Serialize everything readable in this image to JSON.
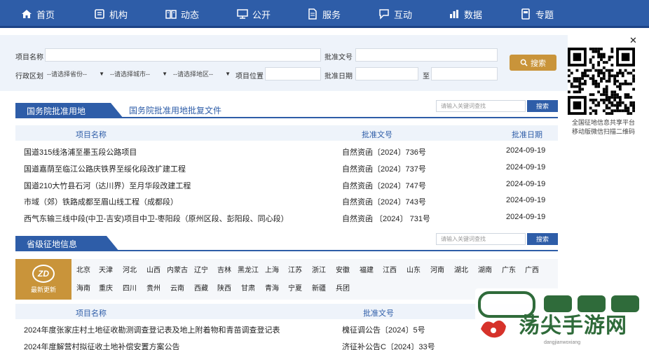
{
  "nav": {
    "items": [
      {
        "label": "首页",
        "icon": "home-icon"
      },
      {
        "label": "机构",
        "icon": "building-icon"
      },
      {
        "label": "动态",
        "icon": "book-icon"
      },
      {
        "label": "公开",
        "icon": "monitor-icon"
      },
      {
        "label": "服务",
        "icon": "document-icon"
      },
      {
        "label": "互动",
        "icon": "chat-icon"
      },
      {
        "label": "数据",
        "icon": "bar-chart-icon"
      },
      {
        "label": "专题",
        "icon": "topic-book-icon"
      }
    ]
  },
  "search": {
    "project_name_label": "项目名称",
    "approval_no_label": "批准文号",
    "region_label": "行政区划",
    "province_select": "--请选择省份--",
    "city_select": "--请选择城市--",
    "district_select": "--请选择地区--",
    "location_label": "项目位置",
    "approval_date_label": "批准日期",
    "to_label": "至",
    "search_button": "搜索"
  },
  "section1": {
    "title": "国务院批准用地",
    "link": "国务院批准用地批复文件",
    "keyword_placeholder": "请输入关键词查找",
    "search_button": "搜索",
    "columns": {
      "name": "项目名称",
      "approval": "批准文号",
      "date": "批准日期"
    },
    "rows": [
      {
        "name": "国道315线洛浦至墨玉段公路项目",
        "approval": "自然资函〔2024〕736号",
        "date": "2024-09-19"
      },
      {
        "name": "国道嘉荫至临江公路庆铁界至绥化段改扩建工程",
        "approval": "自然资函〔2024〕737号",
        "date": "2024-09-19"
      },
      {
        "name": "国道210大竹县石河（达川界）至月华段改建工程",
        "approval": "自然资函〔2024〕747号",
        "date": "2024-09-19"
      },
      {
        "name": "市域（郊）铁路成都至眉山线工程（成都段）",
        "approval": "自然资函〔2024〕743号",
        "date": "2024-09-19"
      },
      {
        "name": "西气东输三线中段(中卫-吉安)项目中卫-枣阳段（原州区段、彭阳段、同心段）",
        "approval": "自然资函 〔2024〕 731号",
        "date": "2024-09-19"
      }
    ]
  },
  "section2": {
    "title": "省级征地信息",
    "keyword_placeholder": "请输入关键词查找",
    "search_button": "搜索",
    "badge_logo": "ZD",
    "badge_text": "最新更新",
    "provinces_row1": [
      "北京",
      "天津",
      "河北",
      "山西",
      "内蒙古",
      "辽宁",
      "吉林",
      "黑龙江",
      "上海",
      "江苏",
      "浙江",
      "安徽",
      "福建",
      "江西",
      "山东",
      "河南",
      "湖北",
      "湖南",
      "广东",
      "广西"
    ],
    "provinces_row2": [
      "海南",
      "重庆",
      "四川",
      "贵州",
      "云南",
      "西藏",
      "陕西",
      "甘肃",
      "青海",
      "宁夏",
      "新疆",
      "兵团"
    ],
    "columns": {
      "name": "项目名称",
      "approval": "批准文号"
    },
    "rows": [
      {
        "name": "2024年度张家庄村土地征收勘测调查登记表及地上附着物和青苗调查登记表",
        "approval": "槐征调公告〔2024〕5号"
      },
      {
        "name": "2024年度解营村拟征收土地补偿安置方案公告",
        "approval": "济征补公告C〔2024〕33号"
      }
    ]
  },
  "qr": {
    "caption_line1": "全国征地信息共享平台",
    "caption_line2": "移动版微信扫描二维码"
  },
  "watermark": {
    "text": "荡尖手游网",
    "url": "dangjianwoxiang"
  },
  "colors": {
    "nav": "#2e5da8",
    "accent": "#c9943a",
    "light_bg": "#eef3fa"
  }
}
